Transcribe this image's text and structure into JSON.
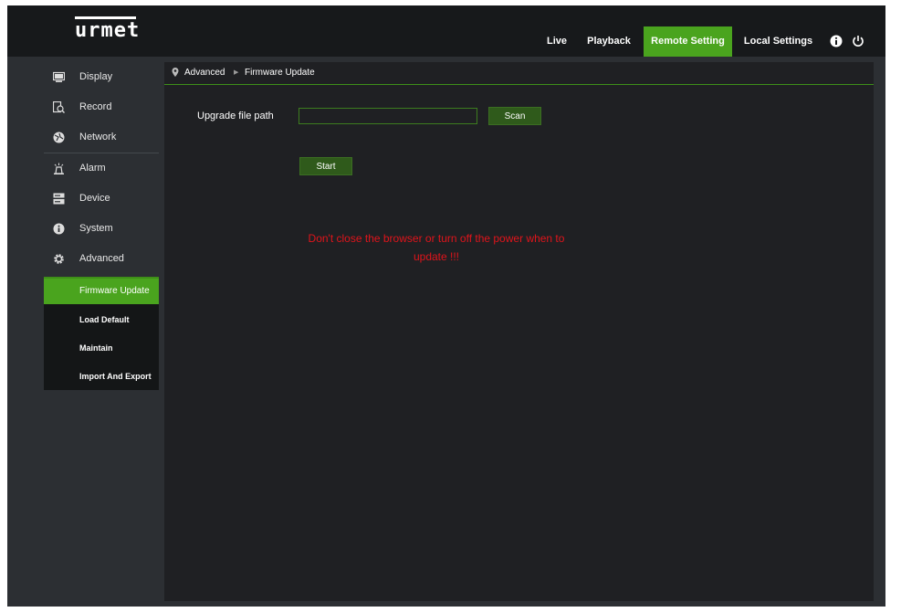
{
  "header": {
    "logo": "urmet",
    "nav": [
      {
        "label": "Live"
      },
      {
        "label": "Playback"
      },
      {
        "label": "Remote Setting",
        "active": true
      },
      {
        "label": "Local Settings"
      }
    ],
    "icons": [
      "info-icon",
      "power-icon"
    ],
    "accent_color": "#4aa41e"
  },
  "sidebar": {
    "items": [
      {
        "label": "Display",
        "icon": "display-icon"
      },
      {
        "label": "Record",
        "icon": "record-icon"
      },
      {
        "label": "Network",
        "icon": "network-icon"
      },
      {
        "label": "Alarm",
        "icon": "alarm-icon"
      },
      {
        "label": "Device",
        "icon": "device-icon"
      },
      {
        "label": "System",
        "icon": "system-info-icon"
      },
      {
        "label": "Advanced",
        "icon": "gear-icon",
        "expanded": true
      }
    ],
    "submenu": [
      {
        "label": "Firmware Update",
        "active": true
      },
      {
        "label": "Load Default"
      },
      {
        "label": "Maintain"
      },
      {
        "label": "Import And Export"
      }
    ]
  },
  "breadcrumb": {
    "parent": "Advanced",
    "current": "Firmware Update"
  },
  "form": {
    "path_label": "Upgrade file path",
    "path_value": "",
    "scan_label": "Scan",
    "start_label": "Start"
  },
  "warning": {
    "line1": "Don't close the browser or turn off the power when to",
    "line2": "update !!!",
    "color": "#e0141b"
  }
}
